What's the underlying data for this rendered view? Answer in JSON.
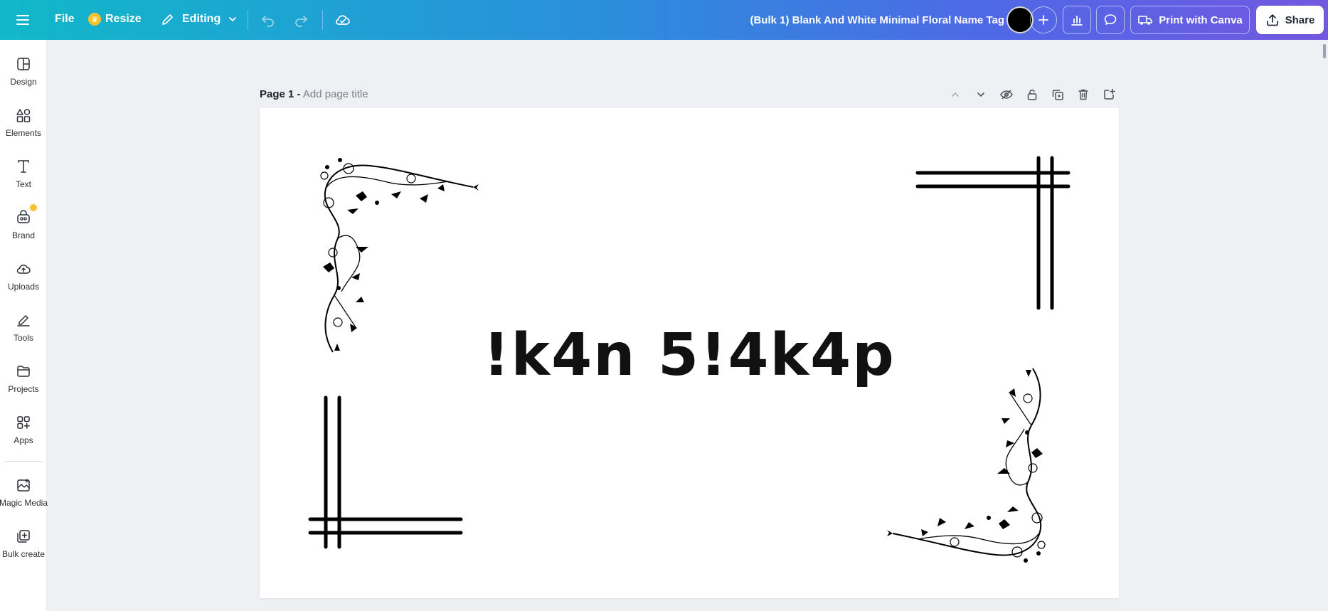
{
  "topbar": {
    "menu_icon": "hamburger-icon",
    "file_label": "File",
    "resize_label": "Resize",
    "editing_label": "Editing",
    "undo_icon": "undo-icon",
    "redo_icon": "redo-icon",
    "save_status_icon": "cloud-check-icon",
    "doc_title": "(Bulk 1) Blank And White Minimal Floral Name Tag",
    "insights_icon": "bar-chart-icon",
    "comments_icon": "comment-icon",
    "print_label": "Print with Canva",
    "share_label": "Share",
    "gradient_colors": [
      "#11b8c9",
      "#2a8fdc",
      "#4f68e6",
      "#7358e0"
    ]
  },
  "sidebar": {
    "items": [
      {
        "label": "Design",
        "icon": "layout-icon"
      },
      {
        "label": "Elements",
        "icon": "shapes-icon"
      },
      {
        "label": "Text",
        "icon": "text-icon"
      },
      {
        "label": "Brand",
        "icon": "brand-icon"
      },
      {
        "label": "Uploads",
        "icon": "cloud-upload-icon"
      },
      {
        "label": "Tools",
        "icon": "pen-tool-icon"
      },
      {
        "label": "Projects",
        "icon": "folder-icon"
      },
      {
        "label": "Apps",
        "icon": "apps-grid-icon"
      },
      {
        "label": "Magic Media",
        "icon": "magic-media-icon"
      },
      {
        "label": "Bulk create",
        "icon": "bulk-create-icon"
      }
    ]
  },
  "page": {
    "label": "Page 1 -",
    "title_placeholder": "Add page title"
  },
  "design": {
    "name_text": "!k4n 5!4k4p",
    "background": "#ffffff",
    "ink": "#000000"
  }
}
